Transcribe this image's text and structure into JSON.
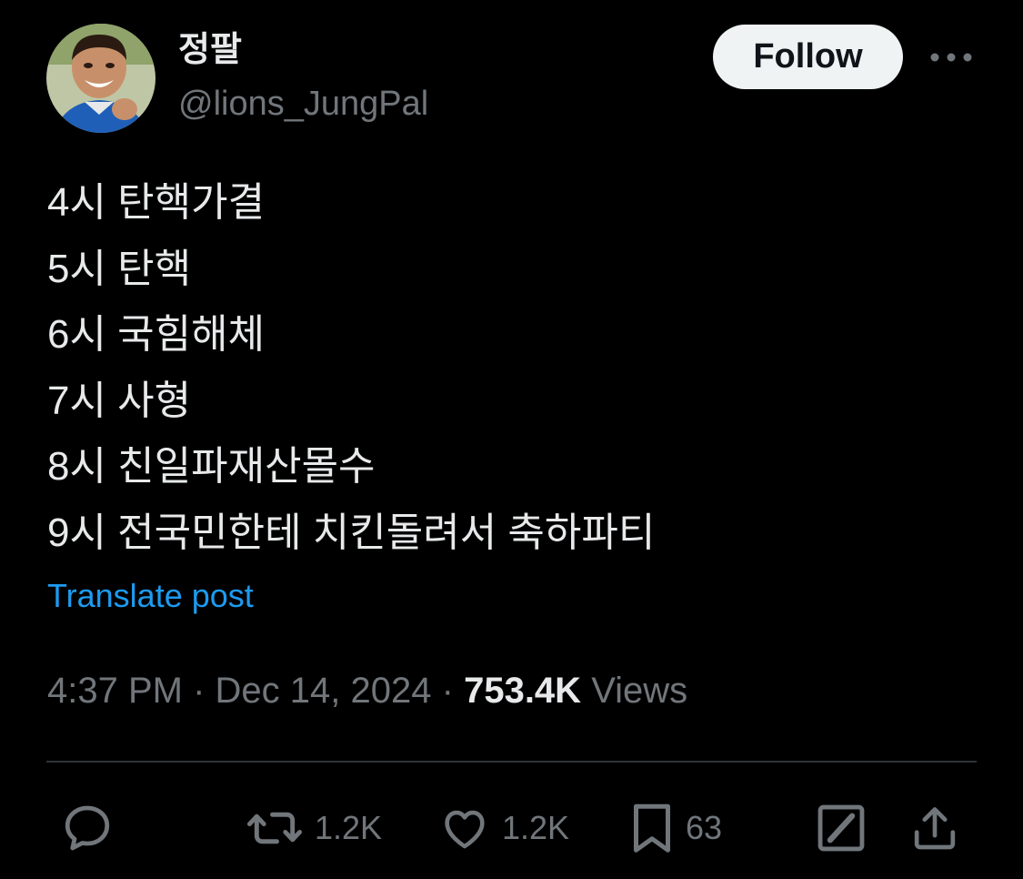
{
  "author": {
    "display_name": "정팔",
    "handle": "@lions_JungPal",
    "avatar_icon": "profile-photo"
  },
  "header": {
    "follow_label": "Follow",
    "more_icon": "more-horizontal-icon"
  },
  "tweet": {
    "lines": [
      "4시 탄핵가결",
      "5시 탄핵",
      "6시 국힘해체",
      "7시 사형",
      "8시 친일파재산몰수",
      "9시 전국민한테 치킨돌려서 축하파티"
    ],
    "translate_label": "Translate post"
  },
  "meta": {
    "time": "4:37 PM",
    "separator": "·",
    "date": "Dec 14, 2024",
    "views_count": "753.4K",
    "views_label": "Views"
  },
  "actions": {
    "reply": {
      "icon": "reply-icon"
    },
    "retweet": {
      "icon": "retweet-icon",
      "count": "1.2K"
    },
    "like": {
      "icon": "heart-icon",
      "count": "1.2K"
    },
    "bookmark": {
      "icon": "bookmark-icon",
      "count": "63"
    },
    "grok": {
      "icon": "grok-icon"
    },
    "share": {
      "icon": "share-icon"
    }
  },
  "colors": {
    "background": "#000000",
    "text_primary": "#e7e9ea",
    "text_secondary": "#71767b",
    "link": "#1d9bf0",
    "follow_button_bg": "#eff3f4",
    "divider": "#2f3336"
  }
}
